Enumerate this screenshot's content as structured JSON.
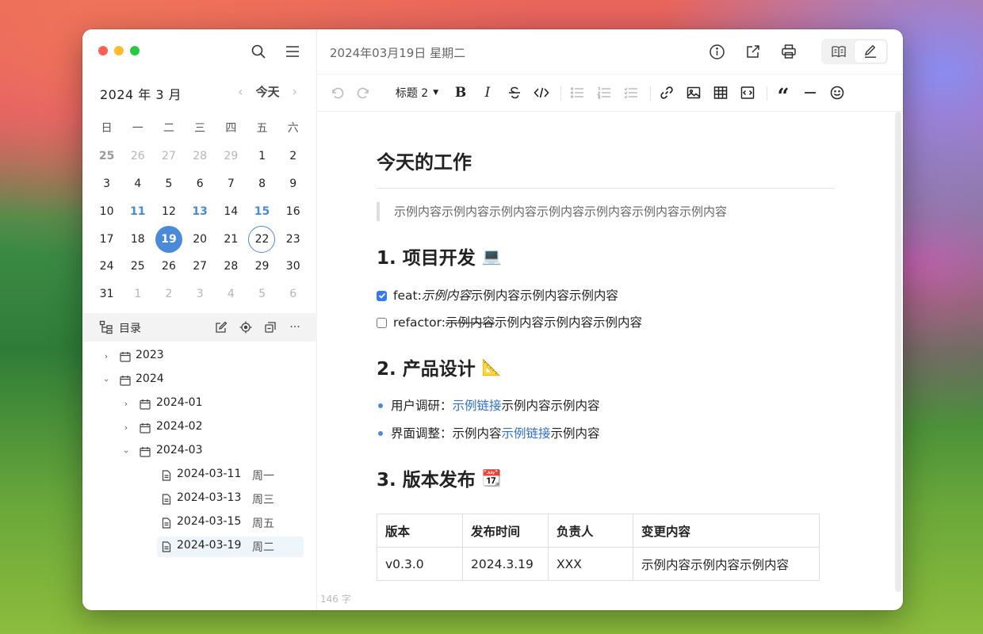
{
  "sidebar": {
    "month_title": "2024 年 3 月",
    "today_label": "今天",
    "prev_arrow": "‹",
    "next_arrow": "›",
    "weekdays": [
      "日",
      "一",
      "二",
      "三",
      "四",
      "五",
      "六"
    ],
    "weeks": [
      [
        "25",
        "26",
        "27",
        "28",
        "29",
        "1",
        "2"
      ],
      [
        "3",
        "4",
        "5",
        "6",
        "7",
        "8",
        "9"
      ],
      [
        "10",
        "11",
        "12",
        "13",
        "14",
        "15",
        "16"
      ],
      [
        "17",
        "18",
        "19",
        "20",
        "21",
        "22",
        "23"
      ],
      [
        "24",
        "25",
        "26",
        "27",
        "28",
        "29",
        "30"
      ],
      [
        "31",
        "1",
        "2",
        "3",
        "4",
        "5",
        "6"
      ]
    ],
    "toc_label": "目录",
    "tree": [
      {
        "label": "2023",
        "weekday": ""
      },
      {
        "label": "2024",
        "weekday": ""
      },
      {
        "label": "2024-01",
        "weekday": ""
      },
      {
        "label": "2024-02",
        "weekday": ""
      },
      {
        "label": "2024-03",
        "weekday": ""
      },
      {
        "label": "2024-03-11",
        "weekday": "周一"
      },
      {
        "label": "2024-03-13",
        "weekday": "周三"
      },
      {
        "label": "2024-03-15",
        "weekday": "周五"
      },
      {
        "label": "2024-03-19",
        "weekday": "周二"
      }
    ]
  },
  "header": {
    "date_title": "2024年03月19日 星期二"
  },
  "toolbar": {
    "heading_style": "标题 2"
  },
  "doc": {
    "title": "今天的工作",
    "quote": "示例内容示例内容示例内容示例内容示例内容示例内容示例内容",
    "section1": {
      "title": "1. 项目开发",
      "emoji": "💻"
    },
    "task1": {
      "prefix": "feat: ",
      "italic": "示例内容",
      "rest": "示例内容示例内容示例内容"
    },
    "task2": {
      "prefix": "refactor: ",
      "strike": "示例内容",
      "rest": "示例内容示例内容示例内容"
    },
    "section2": {
      "title": "2. 产品设计",
      "emoji": "📐"
    },
    "bullet1": {
      "prefix": "用户调研：",
      "link": "示例链接",
      "rest": "示例内容示例内容"
    },
    "bullet2": {
      "prefix": "界面调整：示例内容",
      "link": "示例链接",
      "rest": "示例内容"
    },
    "section3": {
      "title": "3. 版本发布",
      "emoji": "📆"
    },
    "table": {
      "headers": [
        "版本",
        "发布时间",
        "负责人",
        "变更内容"
      ],
      "rows": [
        [
          "v0.3.0",
          "2024.3.19",
          "XXX",
          "示例内容示例内容示例内容"
        ]
      ]
    },
    "word_count": "146 字"
  },
  "colors": {
    "accent": "#4a8ad8",
    "link": "#2f6fd0",
    "checkbox": "#3478f6"
  }
}
